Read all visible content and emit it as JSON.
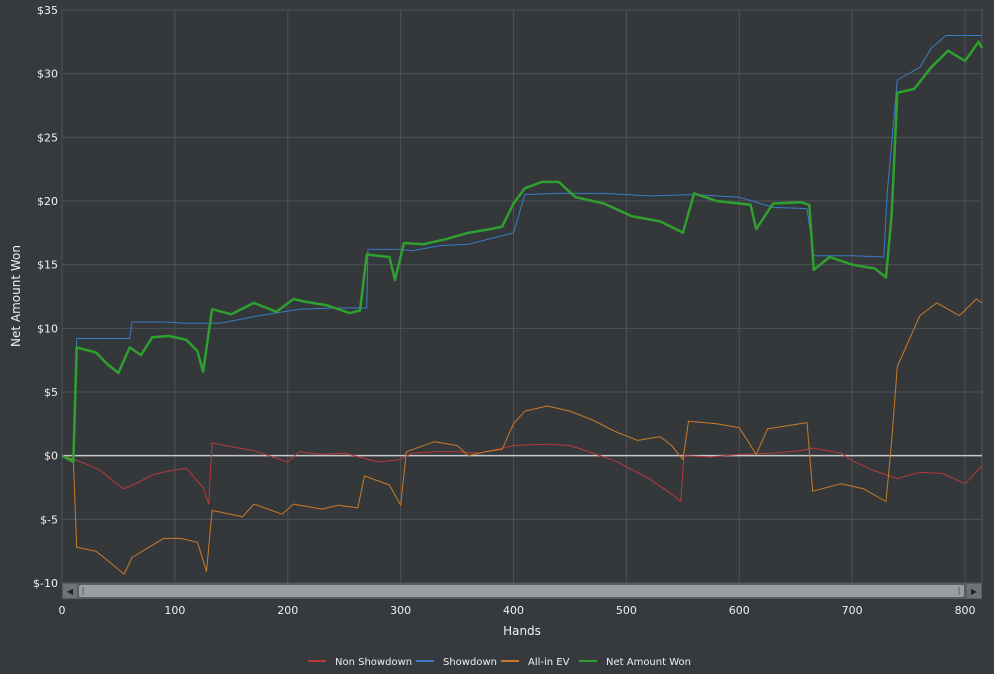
{
  "colors": {
    "background": "#363a3e",
    "plot_background": "#35383b",
    "grid": "#4d5155",
    "zero_line": "#c8c8c8",
    "scrollbar_track": "#5a5e62",
    "scrollbar_thumb": "#9a9ea2"
  },
  "scrollbar": {
    "left_arrow": "◀",
    "right_arrow": "▶"
  },
  "chart_data": {
    "type": "line",
    "xlabel": "Hands",
    "ylabel": "Net Amount Won",
    "xlim": [
      0,
      815
    ],
    "ylim": [
      -10,
      35
    ],
    "x_ticks": [
      0,
      100,
      200,
      300,
      400,
      500,
      600,
      700,
      800
    ],
    "x_tick_labels": [
      "0",
      "100",
      "200",
      "300",
      "400",
      "500",
      "600",
      "700",
      "800"
    ],
    "y_ticks": [
      -10,
      -5,
      0,
      5,
      10,
      15,
      20,
      25,
      30,
      35
    ],
    "y_tick_labels": [
      "$-10",
      "$-5",
      "$0",
      "$5",
      "$10",
      "$15",
      "$20",
      "$25",
      "$30",
      "$35"
    ],
    "grid": true,
    "legend_position": "bottom-center",
    "series": [
      {
        "name": "Non Showdown",
        "color": "#b83a3a",
        "width": 1,
        "points": [
          [
            0,
            0
          ],
          [
            10,
            -0.3
          ],
          [
            20,
            -0.6
          ],
          [
            35,
            -1.2
          ],
          [
            45,
            -2
          ],
          [
            55,
            -2.6
          ],
          [
            70,
            -2
          ],
          [
            80,
            -1.5
          ],
          [
            95,
            -1.2
          ],
          [
            110,
            -1
          ],
          [
            125,
            -2.5
          ],
          [
            130,
            -3.8
          ],
          [
            133,
            1
          ],
          [
            150,
            0.7
          ],
          [
            170,
            0.4
          ],
          [
            200,
            -0.5
          ],
          [
            210,
            0.3
          ],
          [
            230,
            0.1
          ],
          [
            250,
            0.2
          ],
          [
            280,
            -0.5
          ],
          [
            300,
            -0.3
          ],
          [
            310,
            0.2
          ],
          [
            330,
            0.3
          ],
          [
            350,
            0.3
          ],
          [
            370,
            0.2
          ],
          [
            380,
            0.4
          ],
          [
            400,
            0.8
          ],
          [
            430,
            0.9
          ],
          [
            450,
            0.8
          ],
          [
            470,
            0.2
          ],
          [
            490,
            -0.4
          ],
          [
            520,
            -1.8
          ],
          [
            540,
            -3
          ],
          [
            548,
            -3.6
          ],
          [
            551,
            0
          ],
          [
            575,
            -0.1
          ],
          [
            600,
            0.1
          ],
          [
            630,
            0.2
          ],
          [
            655,
            0.4
          ],
          [
            665,
            0.6
          ],
          [
            690,
            0.2
          ],
          [
            700,
            -0.4
          ],
          [
            720,
            -1.2
          ],
          [
            740,
            -1.8
          ],
          [
            760,
            -1.3
          ],
          [
            780,
            -1.4
          ],
          [
            800,
            -2.2
          ],
          [
            815,
            -0.8
          ]
        ]
      },
      {
        "name": "Showdown",
        "color": "#3a7cc4",
        "width": 1,
        "points": [
          [
            10,
            0
          ],
          [
            13,
            9.2
          ],
          [
            30,
            9.2
          ],
          [
            60,
            9.2
          ],
          [
            62,
            10.5
          ],
          [
            90,
            10.5
          ],
          [
            110,
            10.4
          ],
          [
            140,
            10.4
          ],
          [
            175,
            11
          ],
          [
            210,
            11.5
          ],
          [
            240,
            11.6
          ],
          [
            270,
            11.6
          ],
          [
            271,
            16.2
          ],
          [
            300,
            16.2
          ],
          [
            310,
            16.1
          ],
          [
            335,
            16.5
          ],
          [
            360,
            16.6
          ],
          [
            400,
            17.5
          ],
          [
            410,
            20.5
          ],
          [
            440,
            20.6
          ],
          [
            480,
            20.6
          ],
          [
            520,
            20.4
          ],
          [
            560,
            20.5
          ],
          [
            600,
            20.3
          ],
          [
            630,
            19.5
          ],
          [
            660,
            19.4
          ],
          [
            666,
            15.7
          ],
          [
            700,
            15.7
          ],
          [
            728,
            15.6
          ],
          [
            731,
            20.6
          ],
          [
            740,
            29.5
          ],
          [
            760,
            30.5
          ],
          [
            770,
            32
          ],
          [
            783,
            33
          ],
          [
            815,
            33
          ]
        ]
      },
      {
        "name": "All-in EV",
        "color": "#c87a28",
        "width": 1,
        "points": [
          [
            0,
            0
          ],
          [
            10,
            -0.3
          ],
          [
            13,
            -7.2
          ],
          [
            30,
            -7.5
          ],
          [
            40,
            -8.2
          ],
          [
            55,
            -9.3
          ],
          [
            62,
            -8
          ],
          [
            75,
            -7.3
          ],
          [
            90,
            -6.5
          ],
          [
            105,
            -6.5
          ],
          [
            120,
            -6.8
          ],
          [
            128,
            -9.1
          ],
          [
            133,
            -4.3
          ],
          [
            160,
            -4.8
          ],
          [
            170,
            -3.8
          ],
          [
            195,
            -4.6
          ],
          [
            205,
            -3.8
          ],
          [
            230,
            -4.2
          ],
          [
            245,
            -3.9
          ],
          [
            262,
            -4.1
          ],
          [
            268,
            -1.6
          ],
          [
            290,
            -2.3
          ],
          [
            300,
            -3.9
          ],
          [
            305,
            0.3
          ],
          [
            330,
            1.1
          ],
          [
            350,
            0.8
          ],
          [
            360,
            0
          ],
          [
            375,
            0.3
          ],
          [
            390,
            0.5
          ],
          [
            400,
            2.5
          ],
          [
            410,
            3.5
          ],
          [
            430,
            3.9
          ],
          [
            450,
            3.5
          ],
          [
            470,
            2.8
          ],
          [
            490,
            1.9
          ],
          [
            510,
            1.2
          ],
          [
            530,
            1.5
          ],
          [
            540,
            0.8
          ],
          [
            550,
            -0.3
          ],
          [
            555,
            2.7
          ],
          [
            580,
            2.5
          ],
          [
            600,
            2.2
          ],
          [
            615,
            0.1
          ],
          [
            625,
            2.1
          ],
          [
            660,
            2.6
          ],
          [
            665,
            -2.8
          ],
          [
            690,
            -2.2
          ],
          [
            710,
            -2.6
          ],
          [
            730,
            -3.6
          ],
          [
            735,
            1.2
          ],
          [
            740,
            7
          ],
          [
            760,
            11
          ],
          [
            775,
            12
          ],
          [
            795,
            11
          ],
          [
            810,
            12.3
          ],
          [
            815,
            12
          ]
        ]
      },
      {
        "name": "Net Amount Won",
        "color": "#2ea02e",
        "width": 2.5,
        "points": [
          [
            0,
            0
          ],
          [
            10,
            -0.5
          ],
          [
            13,
            8.5
          ],
          [
            30,
            8.1
          ],
          [
            40,
            7.2
          ],
          [
            50,
            6.5
          ],
          [
            60,
            8.5
          ],
          [
            70,
            7.9
          ],
          [
            80,
            9.3
          ],
          [
            95,
            9.4
          ],
          [
            110,
            9.1
          ],
          [
            120,
            8.2
          ],
          [
            125,
            6.6
          ],
          [
            133,
            11.5
          ],
          [
            150,
            11.1
          ],
          [
            170,
            12
          ],
          [
            190,
            11.3
          ],
          [
            205,
            12.3
          ],
          [
            215,
            12.1
          ],
          [
            235,
            11.8
          ],
          [
            255,
            11.2
          ],
          [
            264,
            11.4
          ],
          [
            270,
            15.8
          ],
          [
            290,
            15.6
          ],
          [
            295,
            13.8
          ],
          [
            303,
            16.7
          ],
          [
            320,
            16.6
          ],
          [
            340,
            17
          ],
          [
            360,
            17.5
          ],
          [
            380,
            17.8
          ],
          [
            390,
            18
          ],
          [
            400,
            19.8
          ],
          [
            410,
            21
          ],
          [
            425,
            21.5
          ],
          [
            440,
            21.5
          ],
          [
            455,
            20.3
          ],
          [
            480,
            19.8
          ],
          [
            505,
            18.8
          ],
          [
            530,
            18.4
          ],
          [
            550,
            17.5
          ],
          [
            560,
            20.6
          ],
          [
            580,
            20
          ],
          [
            600,
            19.8
          ],
          [
            610,
            19.7
          ],
          [
            615,
            17.8
          ],
          [
            630,
            19.8
          ],
          [
            655,
            19.9
          ],
          [
            662,
            19.7
          ],
          [
            666,
            14.6
          ],
          [
            680,
            15.6
          ],
          [
            700,
            15
          ],
          [
            720,
            14.7
          ],
          [
            730,
            14
          ],
          [
            735,
            19
          ],
          [
            740,
            28.5
          ],
          [
            755,
            28.8
          ],
          [
            770,
            30.5
          ],
          [
            785,
            31.8
          ],
          [
            800,
            31
          ],
          [
            812,
            32.5
          ],
          [
            815,
            32
          ]
        ]
      }
    ]
  }
}
